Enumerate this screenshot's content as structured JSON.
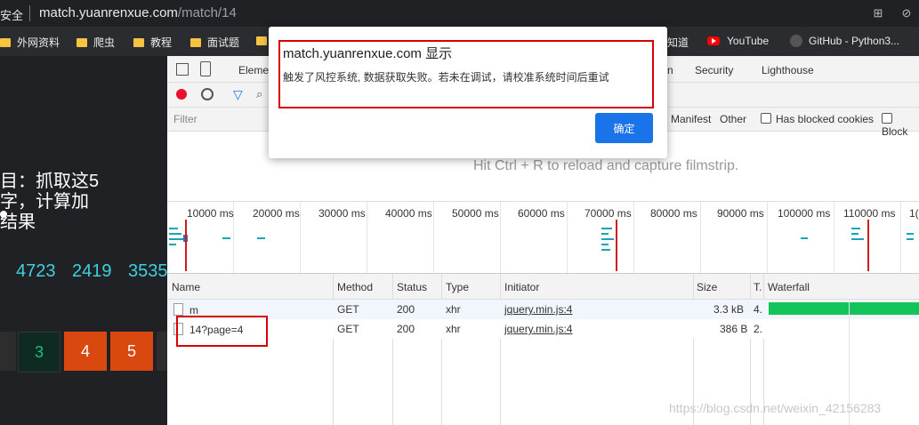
{
  "address_bar": {
    "security": "安全",
    "url_host": "match.yuanrenxue.com",
    "url_path": "/match/14"
  },
  "bookmarks": [
    {
      "label": "外网资料",
      "icon": "folder-icon"
    },
    {
      "label": "爬虫",
      "icon": "folder-icon"
    },
    {
      "label": "教程",
      "icon": "folder-icon"
    },
    {
      "label": "面试题",
      "icon": "folder-icon"
    },
    {
      "label": "知道",
      "icon": "folder-icon"
    },
    {
      "label": "YouTube",
      "icon": "youtube-icon"
    },
    {
      "label": "GitHub - Python3...",
      "icon": "github-icon"
    }
  ],
  "page": {
    "line1": "目：抓取这5",
    "line2": "字，计算加",
    "line3": "结果",
    "numbers": [
      "4723",
      "2419",
      "3535"
    ],
    "pages": [
      "3",
      "4",
      "5"
    ]
  },
  "devtools": {
    "tabs": {
      "elements": "Eleme",
      "n": "n",
      "security": "Security",
      "lighthouse": "Lighthouse"
    },
    "filter_placeholder": "Filter",
    "filter_types": {
      "manifest": "Manifest",
      "other": "Other",
      "blocked_cookies": "Has blocked cookies",
      "blocked": "Block"
    },
    "hint": "Hit Ctrl + R to reload and capture filmstrip.",
    "timeline_ticks": [
      "10000 ms",
      "20000 ms",
      "30000 ms",
      "40000 ms",
      "50000 ms",
      "60000 ms",
      "70000 ms",
      "80000 ms",
      "90000 ms",
      "100000 ms",
      "110000 ms",
      "1("
    ],
    "columns": {
      "name": "Name",
      "method": "Method",
      "status": "Status",
      "type": "Type",
      "initiator": "Initiator",
      "size": "Size",
      "time": "T.",
      "waterfall": "Waterfall"
    },
    "rows": [
      {
        "name": "m",
        "method": "GET",
        "status": "200",
        "type": "xhr",
        "initiator": "jquery.min.js:4",
        "size": "3.3 kB",
        "time": "4."
      },
      {
        "name": "14?page=4",
        "method": "GET",
        "status": "200",
        "type": "xhr",
        "initiator": "jquery.min.js:4",
        "size": "386 B",
        "time": "2."
      }
    ]
  },
  "dialog": {
    "title": "match.yuanrenxue.com 显示",
    "message": "触发了风控系统, 数据获取失败。若未在调试，请校准系统时间后重试",
    "ok_label": "确定"
  },
  "watermark": "https://blog.csdn.net/weixin_42156283",
  "colors": {
    "accent": "#1a73e8",
    "highlight": "#d80000",
    "page_number_active": "#d9480f",
    "number_text": "#3fd0e0"
  }
}
